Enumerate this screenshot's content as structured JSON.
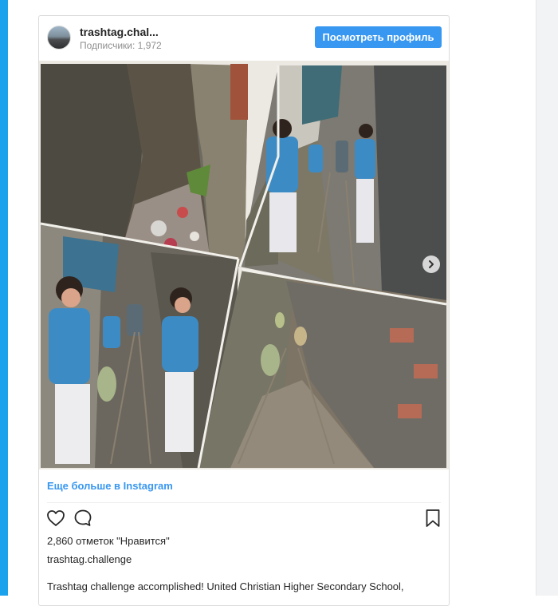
{
  "post": {
    "username": "trashtag.chal...",
    "followers": "Подписчики: 1,972",
    "view_profile_label": "Посмотреть профиль",
    "more_link": "Еще больше в Instagram",
    "likes": "2,860 отметок \"Нравится\"",
    "owner": "trashtag.challenge",
    "caption": "Trashtag challenge accomplished! United Christian Higher Secondary School,"
  },
  "icons": {
    "like": "heart-icon",
    "comment": "comment-icon",
    "save": "bookmark-icon",
    "next": "chevron-right-icon"
  },
  "colors": {
    "accent": "#3897f0",
    "left_bar": "#1aa3ec"
  }
}
